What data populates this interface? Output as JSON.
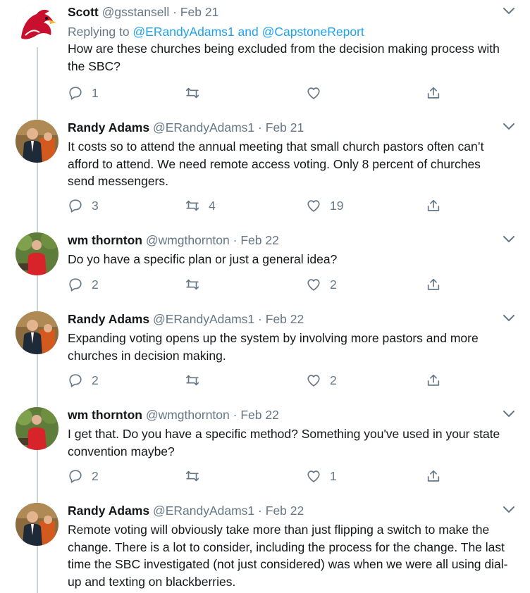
{
  "tweets": [
    {
      "name": "Scott",
      "handle": "@gsstansell",
      "date": "Feb 21",
      "replying_prefix": "Replying to ",
      "replying_to": [
        "@ERandyAdams1",
        "@CapstoneReport"
      ],
      "replying_joiner": " and ",
      "text": "How are these churches being excluded from the decision making process with the SBC?",
      "counts": {
        "reply": "1",
        "retweet": "",
        "like": ""
      },
      "avatar": "mascot-avatar"
    },
    {
      "name": "Randy Adams",
      "handle": "@ERandyAdams1",
      "date": "Feb 21",
      "text": "It costs so to attend the annual meeting that small church pastors often can’t afford to attend.  We need remote access voting.  Only 8 percent of churches send messengers.",
      "counts": {
        "reply": "3",
        "retweet": "4",
        "like": "19"
      },
      "avatar": "person-avatar"
    },
    {
      "name": "wm thornton",
      "handle": "@wmgthornton",
      "date": "Feb 22",
      "text": "Do yo have a specific plan or just a general idea?",
      "counts": {
        "reply": "2",
        "retweet": "",
        "like": "2"
      },
      "avatar": "outdoor-avatar"
    },
    {
      "name": "Randy Adams",
      "handle": "@ERandyAdams1",
      "date": "Feb 22",
      "text": "Expanding voting opens up the system by involving more pastors and more churches in decision making.",
      "counts": {
        "reply": "2",
        "retweet": "",
        "like": "2"
      },
      "avatar": "person-avatar"
    },
    {
      "name": "wm thornton",
      "handle": "@wmgthornton",
      "date": "Feb 22",
      "text": "I get that. Do you have a specific method? Something you've used in your state convention maybe?",
      "counts": {
        "reply": "2",
        "retweet": "",
        "like": "1"
      },
      "avatar": "outdoor-avatar"
    },
    {
      "name": "Randy Adams",
      "handle": "@ERandyAdams1",
      "date": "Feb 22",
      "text": "Remote voting will obviously take more than just flipping a switch to make the change. There is a lot to consider, including the process for the change. The last time the SBC investigated (not just considered) was when we were all using dial-up and texting on blackberries.",
      "counts": null,
      "avatar": "person-avatar"
    }
  ],
  "separator": "·",
  "colors": {
    "accent": "#1da1f2",
    "secondary_text": "#657786",
    "primary_text": "#14171a",
    "thread_line": "#ccd6dd"
  }
}
